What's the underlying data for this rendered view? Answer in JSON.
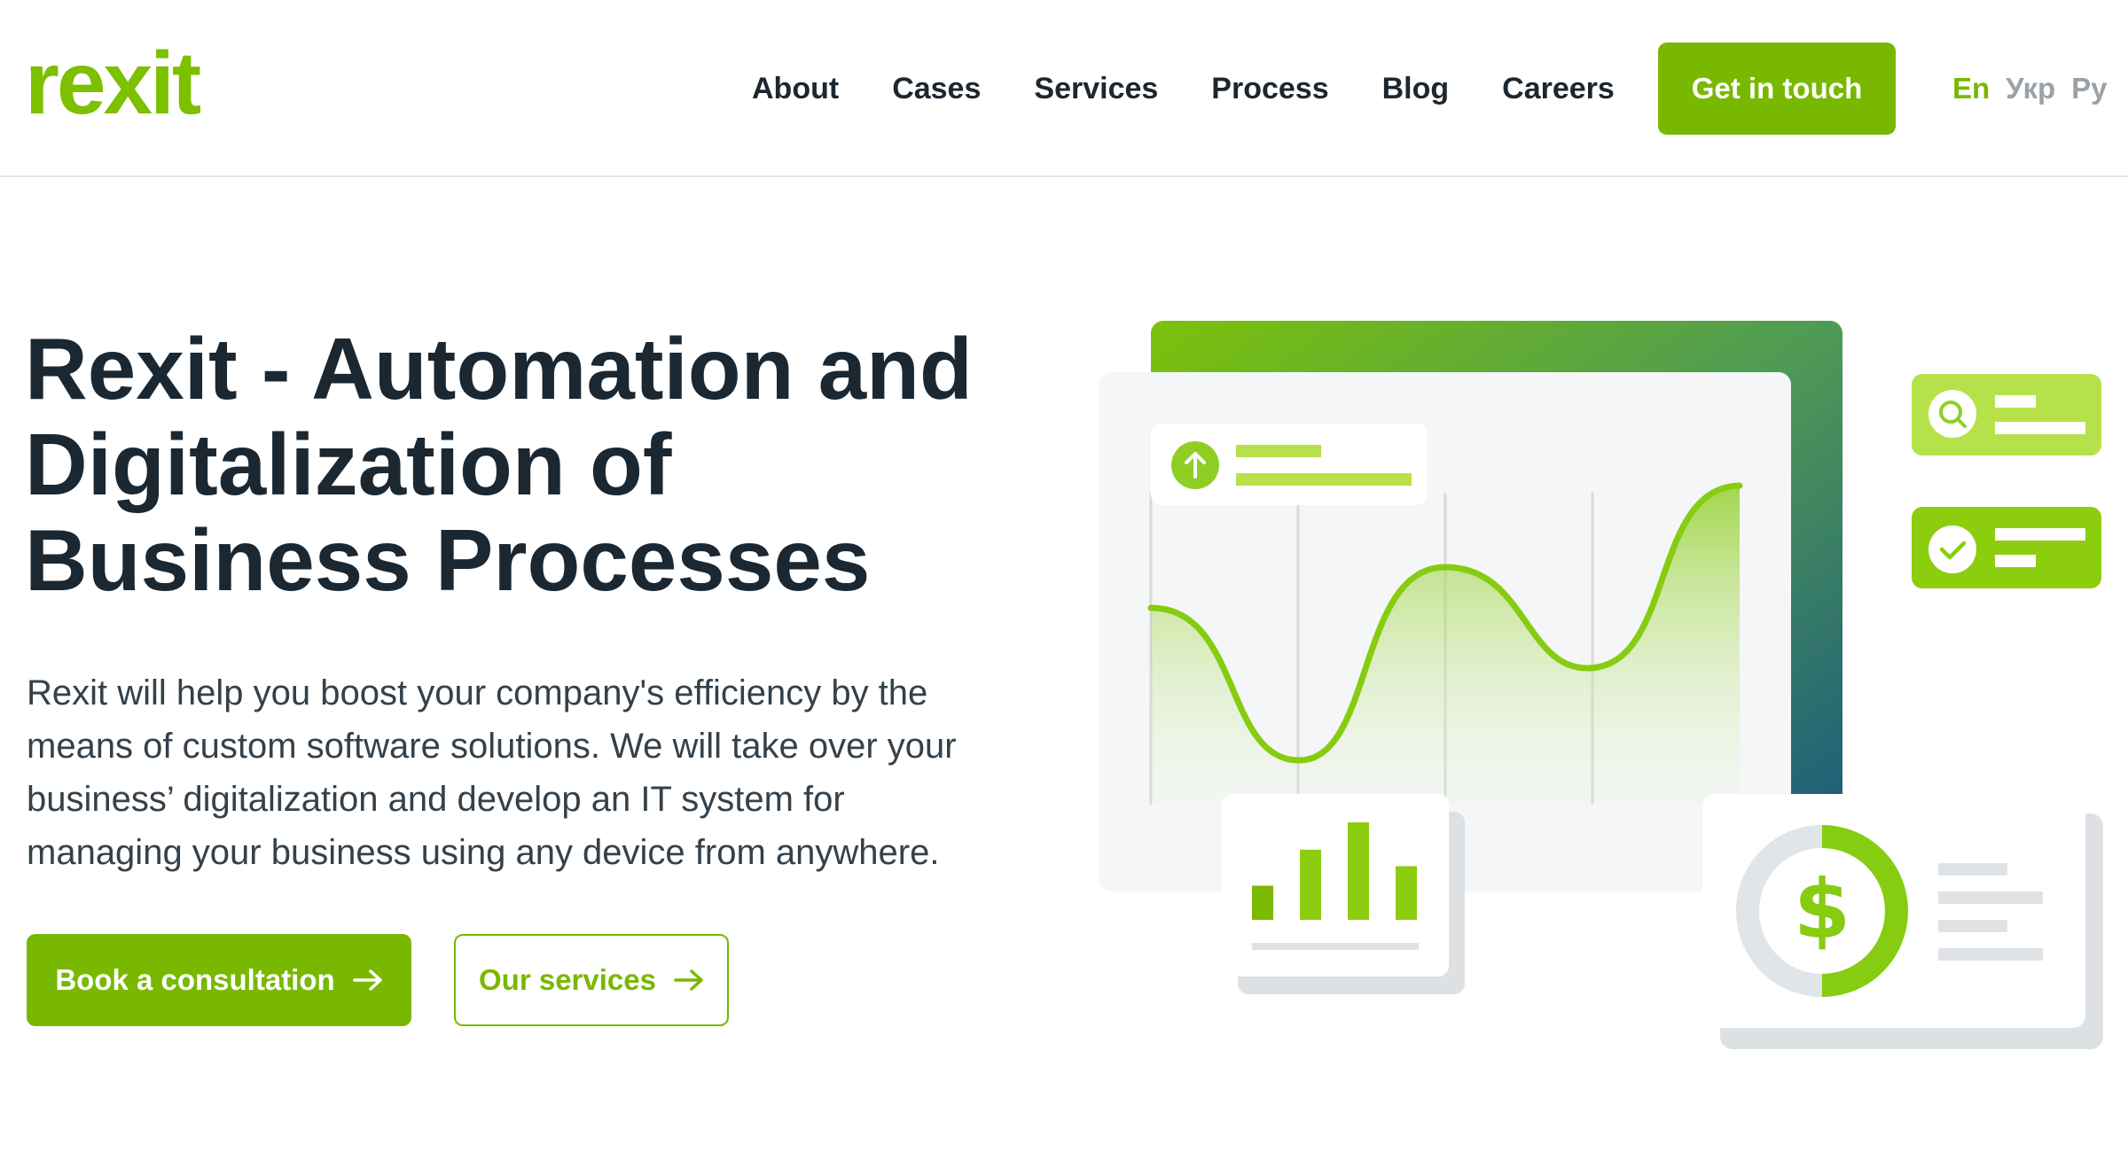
{
  "header": {
    "logo": "rexit",
    "nav": [
      "About",
      "Cases",
      "Services",
      "Process",
      "Blog",
      "Careers"
    ],
    "cta_label": "Get in touch",
    "languages": [
      {
        "label": "En",
        "active": true
      },
      {
        "label": "Укр",
        "active": false
      },
      {
        "label": "Ру",
        "active": false
      }
    ]
  },
  "hero": {
    "title_lines": [
      "Rexit - Automation and",
      "Digitalization of",
      "Business Processes"
    ],
    "description_lines": [
      "Rexit will help you boost your company's efficiency by the",
      "means of custom software solutions. We will take over your",
      "business’ digitalization and develop an IT system for",
      "managing your business using any device from anywhere."
    ],
    "primary_button": "Book a consultation",
    "secondary_button": "Our services"
  },
  "illustration": {
    "currency_symbol": "$",
    "donut_progress": 0.5,
    "bar_values": [
      0.35,
      0.72,
      1.0,
      0.55
    ]
  },
  "colors": {
    "brand_green": "#79b800",
    "light_green": "#b5e24a",
    "text_dark": "#1b2731",
    "gradient_end": "#1f5c7a"
  }
}
